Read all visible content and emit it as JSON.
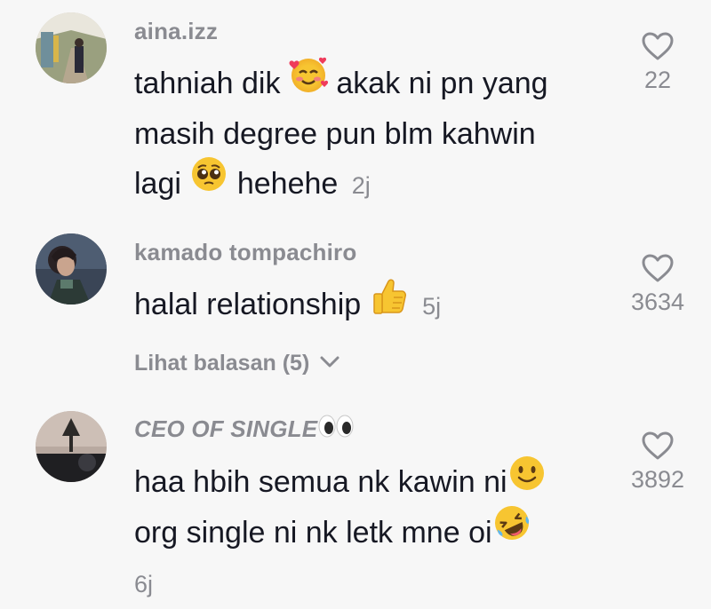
{
  "comments": [
    {
      "username": "aina.izz",
      "line1_a": "tahniah dik",
      "line1_b": "akak ni pn yang",
      "line2": "masih degree pun blm kahwin",
      "line3_a": "lagi",
      "line3_b": "hehehe",
      "time": "2j",
      "likes": "22",
      "emojis": [
        "smiling-face-with-hearts",
        "pleading-face"
      ]
    },
    {
      "username": "kamado tompachiro",
      "text": "halal relationship",
      "time": "5j",
      "likes": "3634",
      "replies_label": "Lihat balasan (5)",
      "emojis": [
        "thumbs-up"
      ]
    },
    {
      "username": "CEO OF SINGLE",
      "line1": "haa hbih semua nk kawin ni",
      "line2": "org single ni nk letk mne oi",
      "time": "6j",
      "likes": "3892",
      "emojis": [
        "eyes",
        "slightly-smiling-face",
        "rolling-on-floor-laughing"
      ]
    }
  ],
  "colors": {
    "background": "#f7f7f7",
    "primary_text": "#161823",
    "secondary_text": "#8a8b91"
  }
}
